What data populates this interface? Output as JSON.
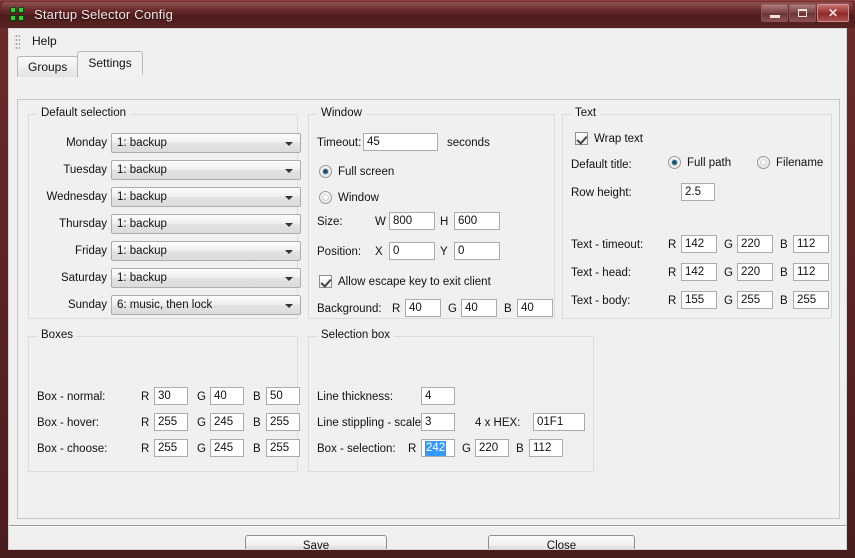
{
  "window": {
    "title": "Startup Selector Config",
    "icon": "app-grid-icon",
    "caption": {
      "minimize": "minimize-icon",
      "maximize": "maximize-icon",
      "close": "✕"
    }
  },
  "menu": {
    "items": [
      "Help"
    ]
  },
  "tabs": [
    {
      "label": "Groups",
      "active": false
    },
    {
      "label": "Settings",
      "active": true
    }
  ],
  "default_selection": {
    "title": "Default selection",
    "rows": [
      {
        "label": "Monday",
        "value": "1: backup"
      },
      {
        "label": "Tuesday",
        "value": "1: backup"
      },
      {
        "label": "Wednesday",
        "value": "1: backup"
      },
      {
        "label": "Thursday",
        "value": "1: backup"
      },
      {
        "label": "Friday",
        "value": "1: backup"
      },
      {
        "label": "Saturday",
        "value": "1: backup"
      },
      {
        "label": "Sunday",
        "value": "6: music, then lock"
      }
    ]
  },
  "window_group": {
    "title": "Window",
    "timeout_label": "Timeout:",
    "timeout_value": "45",
    "seconds_label": "seconds",
    "radio_full_screen": "Full screen",
    "radio_window": "Window",
    "radio_selected": "Full screen",
    "size_label": "Size:",
    "size_w_label": "W",
    "size_w_value": "800",
    "size_h_label": "H",
    "size_h_value": "600",
    "position_label": "Position:",
    "pos_x_label": "X",
    "pos_x_value": "0",
    "pos_y_label": "Y",
    "pos_y_value": "0",
    "escape_label": "Allow escape key to exit client",
    "escape_checked": true,
    "background_label": "Background:",
    "bg_r_label": "R",
    "bg_r_value": "40",
    "bg_g_label": "G",
    "bg_g_value": "40",
    "bg_b_label": "B",
    "bg_b_value": "40"
  },
  "text_group": {
    "title": "Text",
    "wrap_label": "Wrap text",
    "wrap_checked": true,
    "default_title_label": "Default title:",
    "radio_full_path": "Full path",
    "radio_filename": "Filename",
    "default_title_selected": "Full path",
    "row_height_label": "Row height:",
    "row_height_value": "2.5",
    "colors": [
      {
        "label": "Text - timeout:",
        "r_label": "R",
        "r": "142",
        "g_label": "G",
        "g": "220",
        "b_label": "B",
        "b": "112"
      },
      {
        "label": "Text - head:",
        "r_label": "R",
        "r": "142",
        "g_label": "G",
        "g": "220",
        "b_label": "B",
        "b": "112"
      },
      {
        "label": "Text - body:",
        "r_label": "R",
        "r": "155",
        "g_label": "G",
        "g": "255",
        "b_label": "B",
        "b": "255"
      }
    ]
  },
  "boxes_group": {
    "title": "Boxes",
    "rows": [
      {
        "label": "Box - normal:",
        "r_label": "R",
        "r": "30",
        "g_label": "G",
        "g": "40",
        "b_label": "B",
        "b": "50"
      },
      {
        "label": "Box - hover:",
        "r_label": "R",
        "r": "255",
        "g_label": "G",
        "g": "245",
        "b_label": "B",
        "b": "255"
      },
      {
        "label": "Box - choose:",
        "r_label": "R",
        "r": "255",
        "g_label": "G",
        "g": "245",
        "b_label": "B",
        "b": "255"
      }
    ]
  },
  "selection_box_group": {
    "title": "Selection box",
    "line_thickness_label": "Line thickness:",
    "line_thickness_value": "4",
    "stipple_label": "Line stippling - scale:",
    "stipple_value": "3",
    "hex_label": "4 x HEX:",
    "hex_value": "01F1",
    "box_selection_label": "Box - selection:",
    "sel_r_label": "R",
    "sel_r_value": "242",
    "sel_g_label": "G",
    "sel_g_value": "220",
    "sel_b_label": "B",
    "sel_b_value": "112"
  },
  "footer": {
    "save_label": "Save",
    "close_label": "Close"
  }
}
